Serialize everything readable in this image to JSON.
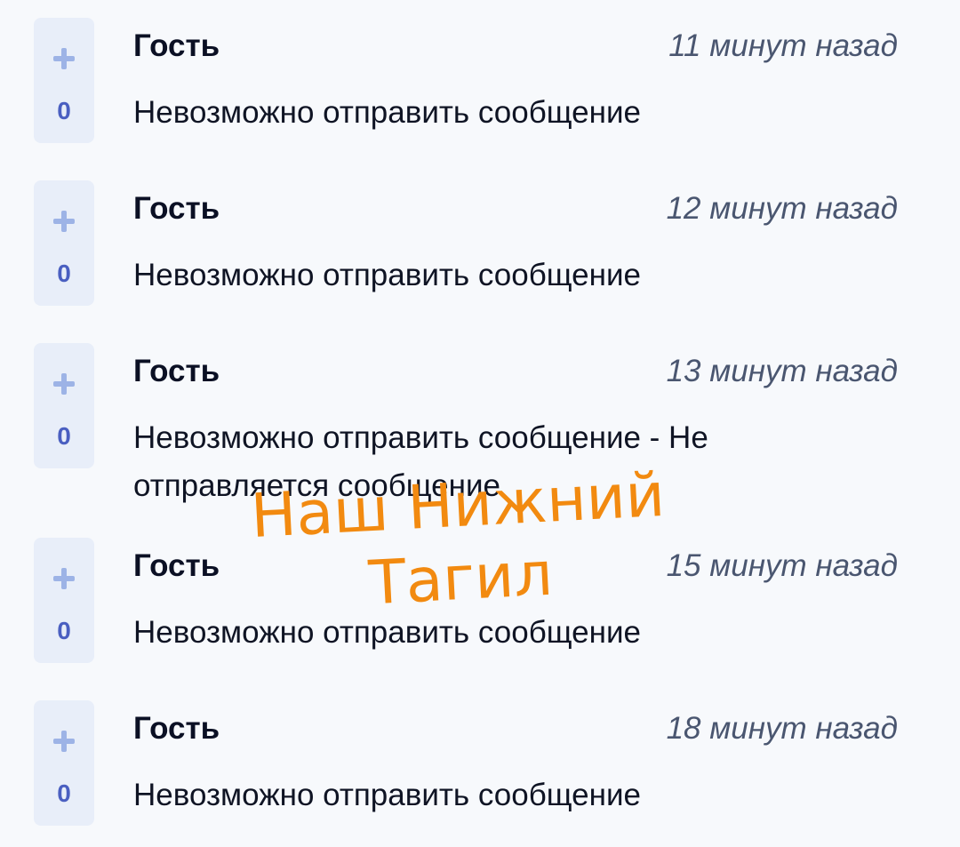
{
  "comments": [
    {
      "author": "Гость",
      "time": "11 минут назад",
      "votes": "0",
      "text": "Невозможно отправить сообщение"
    },
    {
      "author": "Гость",
      "time": "12 минут назад",
      "votes": "0",
      "text": "Невозможно отправить сообщение"
    },
    {
      "author": "Гость",
      "time": "13 минут назад",
      "votes": "0",
      "text": "Невозможно отправить сообщение - Не отправляется сообщение"
    },
    {
      "author": "Гость",
      "time": "15 минут назад",
      "votes": "0",
      "text": "Невозможно отправить сообщение"
    },
    {
      "author": "Гость",
      "time": "18 минут назад",
      "votes": "0",
      "text": "Невозможно отправить сообщение"
    }
  ],
  "watermark": {
    "line1": "Наш Нижний",
    "line2": "Тагил",
    "color": "#f28a10"
  },
  "colors": {
    "vote_bg": "#e8eef9",
    "plus_icon": "#9db3e6",
    "vote_count": "#4a5fc1",
    "author": "#0b1024",
    "time": "#4a5670"
  }
}
